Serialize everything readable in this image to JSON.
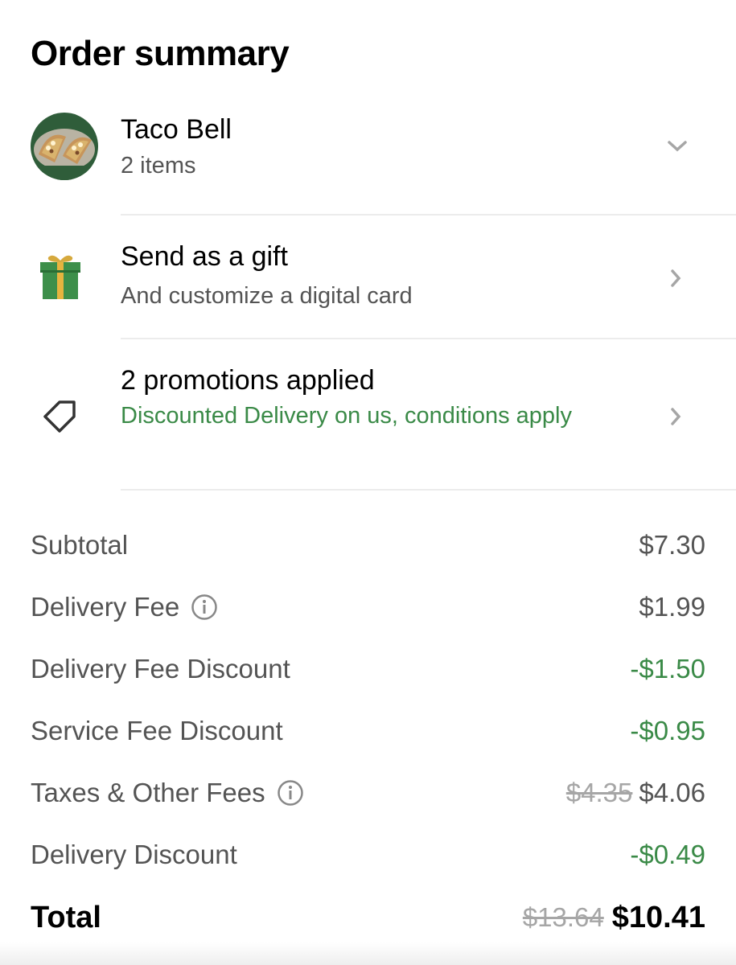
{
  "title": "Order summary",
  "store": {
    "name": "Taco Bell",
    "items": "2 items",
    "avatar_icon": "taco-food-image"
  },
  "gift": {
    "title": "Send as a gift",
    "subtitle": "And customize a digital card",
    "icon": "gift-icon"
  },
  "promotions": {
    "title": "2 promotions applied",
    "subtitle": "Discounted Delivery on us, conditions apply",
    "icon": "tag-icon"
  },
  "fees": {
    "subtotal": {
      "label": "Subtotal",
      "value": "$7.30"
    },
    "delivery_fee": {
      "label": "Delivery Fee",
      "value": "$1.99"
    },
    "delivery_fee_discount": {
      "label": "Delivery Fee Discount",
      "value": "-$1.50"
    },
    "service_fee_discount": {
      "label": "Service Fee Discount",
      "value": "-$0.95"
    },
    "taxes": {
      "label": "Taxes & Other Fees",
      "original": "$4.35",
      "value": "$4.06"
    },
    "delivery_discount": {
      "label": "Delivery Discount",
      "value": "-$0.49"
    }
  },
  "total": {
    "label": "Total",
    "original": "$13.64",
    "value": "$10.41"
  },
  "colors": {
    "discount_green": "#3a8a47",
    "secondary_text": "#545454",
    "muted": "#a6a6a6",
    "divider": "#ececec"
  }
}
